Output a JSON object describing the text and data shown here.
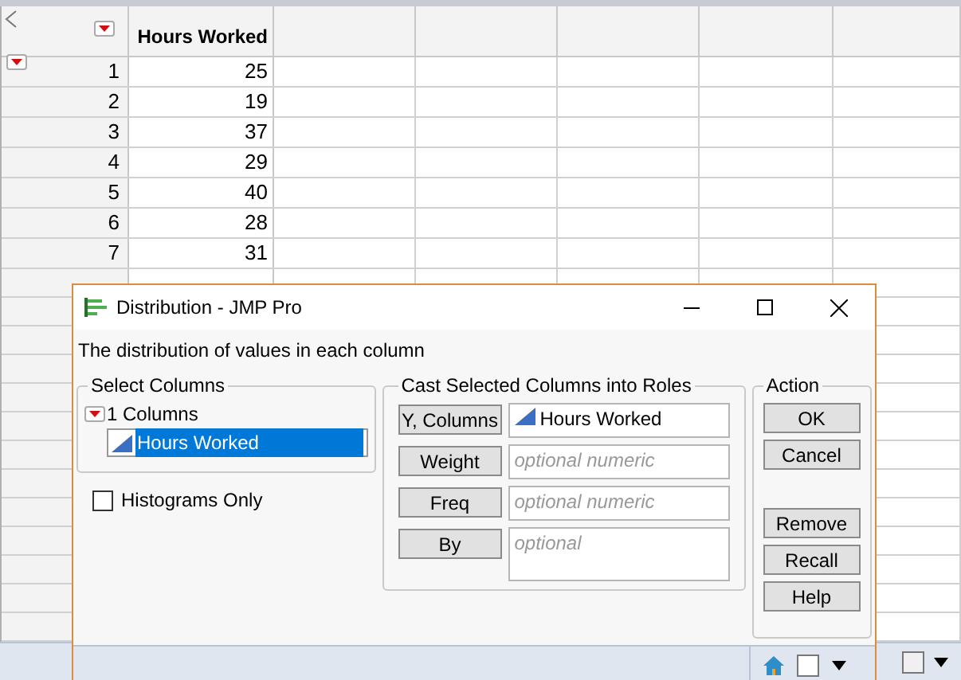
{
  "table": {
    "columns": [
      "Hours Worked"
    ],
    "rows": [
      {
        "number": "1",
        "value": "25"
      },
      {
        "number": "2",
        "value": "19"
      },
      {
        "number": "3",
        "value": "37"
      },
      {
        "number": "4",
        "value": "29"
      },
      {
        "number": "5",
        "value": "40"
      },
      {
        "number": "6",
        "value": "28"
      },
      {
        "number": "7",
        "value": "31"
      }
    ]
  },
  "dialog": {
    "title": "Distribution - JMP Pro",
    "description": "The distribution of values in each column",
    "select_columns": {
      "title": "Select Columns",
      "group": "1 Columns",
      "items": [
        {
          "label": "Hours Worked",
          "selected": true
        }
      ]
    },
    "histograms_only": {
      "label": "Histograms Only",
      "checked": false
    },
    "roles": {
      "title": "Cast Selected Columns into Roles",
      "rows": [
        {
          "button": "Y, Columns",
          "value": "Hours Worked"
        },
        {
          "button": "Weight",
          "placeholder": "optional numeric"
        },
        {
          "button": "Freq",
          "placeholder": "optional numeric"
        },
        {
          "button": "By",
          "placeholder": "optional",
          "tall": true
        }
      ]
    },
    "action": {
      "title": "Action",
      "buttons_top": [
        "OK",
        "Cancel"
      ],
      "buttons_bottom": [
        "Remove",
        "Recall",
        "Help"
      ]
    }
  }
}
